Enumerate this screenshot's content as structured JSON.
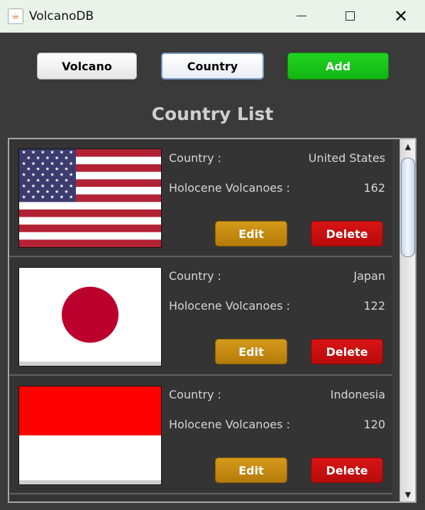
{
  "window": {
    "title": "VolcanoDB",
    "icon": "java-cup-icon"
  },
  "toolbar": {
    "volcano_label": "Volcano",
    "country_label": "Country",
    "add_label": "Add"
  },
  "heading": "Country List",
  "countries": [
    {
      "country_label": "Country :",
      "country_value": "United States",
      "volcano_label": "Holocene Volcanoes :",
      "volcano_count": "162",
      "edit_label": "Edit",
      "delete_label": "Delete",
      "flag": "us-flag"
    },
    {
      "country_label": "Country :",
      "country_value": "Japan",
      "volcano_label": "Holocene Volcanoes :",
      "volcano_count": "122",
      "edit_label": "Edit",
      "delete_label": "Delete",
      "flag": "japan-flag"
    },
    {
      "country_label": "Country :",
      "country_value": "Indonesia",
      "volcano_label": "Holocene Volcanoes :",
      "volcano_count": "120",
      "edit_label": "Edit",
      "delete_label": "Delete",
      "flag": "indonesia-flag"
    }
  ],
  "colors": {
    "add": "#16c416",
    "edit": "#c48a12",
    "delete": "#c81010",
    "background": "#3a3a3a"
  }
}
